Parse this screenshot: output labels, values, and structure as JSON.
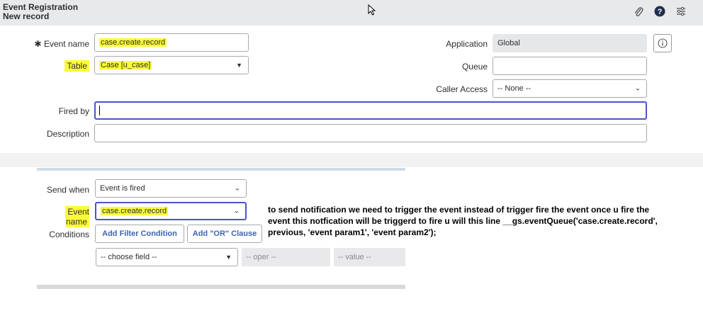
{
  "header": {
    "title": "Event Registration",
    "subtitle": "New record",
    "icons": [
      "paperclip-icon",
      "help-icon",
      "settings-sliders-icon"
    ]
  },
  "form": {
    "event_name_label": "Event name",
    "event_name_value": "case.create.record",
    "required_mark": "✱",
    "table_label": "Table",
    "table_value": "Case [u_case]",
    "fired_by_label": "Fired by",
    "fired_by_value": "",
    "description_label": "Description",
    "description_value": "",
    "application_label": "Application",
    "application_value": "Global",
    "queue_label": "Queue",
    "queue_value": "",
    "caller_access_label": "Caller Access",
    "caller_access_value": "-- None --"
  },
  "notification": {
    "send_when_label": "Send when",
    "send_when_value": "Event is fired",
    "event_name_label": "Event name",
    "event_name_value": "case.create.record",
    "conditions_label": "Conditions",
    "add_filter_label": "Add Filter Condition",
    "add_or_label": "Add \"OR\" Clause",
    "choose_field": "-- choose field --",
    "oper": "-- oper --",
    "value": "-- value --"
  },
  "annotation": {
    "line1": "to send notification we need to trigger the event instead of trigger fire the event once u fire the",
    "line2": "event this notfication will be triggerd  to fire u will this line __gs.eventQueue('case.create.record',",
    "line3": "previous, 'event param1', 'event param2');"
  },
  "colors": {
    "highlight": "#fbfb3a",
    "focus_border": "#4b55c8",
    "link_blue": "#3c64b4"
  }
}
